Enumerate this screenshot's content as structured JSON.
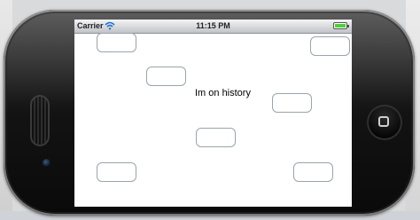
{
  "status_bar": {
    "carrier": "Carrier",
    "time": "11:15 PM",
    "wifi_icon": "wifi-icon",
    "battery_icon": "battery-icon",
    "battery_level": 1.0,
    "battery_color": "#4cd137"
  },
  "main": {
    "label": "Im on history",
    "buttons": [
      "",
      "",
      "",
      "",
      "",
      "",
      ""
    ]
  },
  "device": {
    "home_button_icon": "home-button-icon"
  }
}
